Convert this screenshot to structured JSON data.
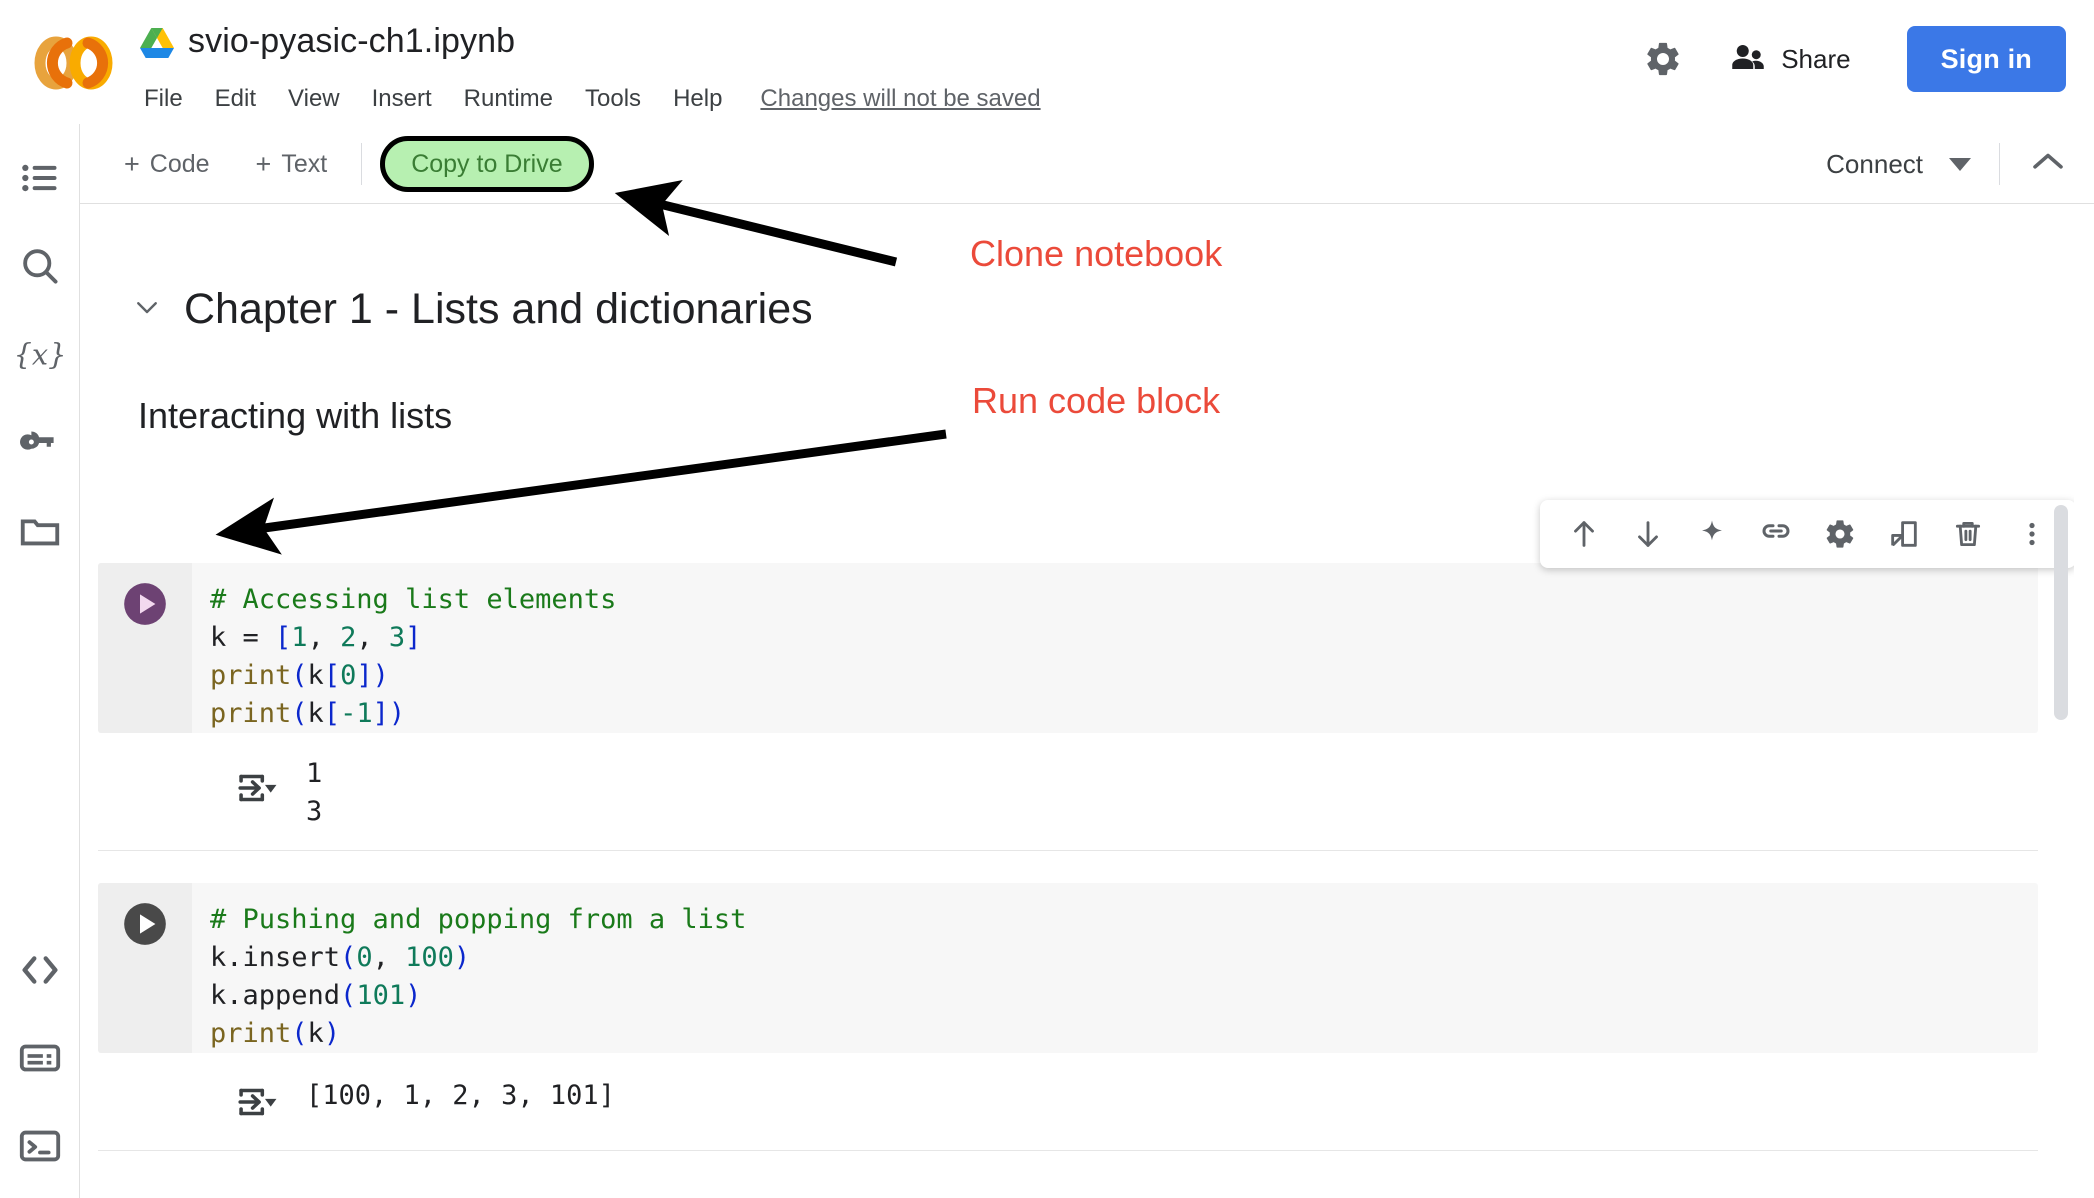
{
  "header": {
    "logo_name": "colab-logo",
    "drive_icon": "google-drive-icon",
    "notebook_title": "svio-pyasic-ch1.ipynb",
    "menu": [
      "File",
      "Edit",
      "View",
      "Insert",
      "Runtime",
      "Tools",
      "Help"
    ],
    "save_status": "Changes will not be saved",
    "settings_icon": "gear-icon",
    "share_icon": "people-icon",
    "share_label": "Share",
    "signin_label": "Sign in",
    "signin_color": "#3b78e7"
  },
  "toolbar": {
    "add_code_label": "Code",
    "add_text_label": "Text",
    "plus_glyph": "+",
    "copy_to_drive_label": "Copy to Drive",
    "copy_to_drive_fill": "#b7f0b1",
    "copy_to_drive_text_color": "#3a7d34",
    "connect_label": "Connect",
    "chevron_down_icon": "chevron-down-icon",
    "collapse_icon": "chevron-up-icon"
  },
  "sidebar": {
    "items": [
      {
        "name": "table-of-contents-icon",
        "label": "Table of contents"
      },
      {
        "name": "search-icon",
        "label": "Find and replace"
      },
      {
        "name": "variables-icon",
        "label": "Variables"
      },
      {
        "name": "secrets-key-icon",
        "label": "Secrets"
      },
      {
        "name": "files-folder-icon",
        "label": "Files"
      }
    ],
    "bottom_items": [
      {
        "name": "code-snippets-icon",
        "label": "Code snippets"
      },
      {
        "name": "command-palette-icon",
        "label": "Command palette"
      },
      {
        "name": "terminal-icon",
        "label": "Terminal"
      }
    ]
  },
  "notebook": {
    "heading1": "Chapter 1 - Lists and dictionaries",
    "heading1_chevron": "chevron-down-icon",
    "heading2": "Interacting with lists",
    "cells": [
      {
        "type": "code",
        "run_icon": "play-circle-icon",
        "highlighted": true,
        "lines": [
          [
            {
              "t": "# Accessing list elements",
              "c": "com"
            }
          ],
          [
            {
              "t": "k ",
              "c": "plain"
            },
            {
              "t": "= ",
              "c": "plain"
            },
            {
              "t": "[",
              "c": "br"
            },
            {
              "t": "1",
              "c": "num"
            },
            {
              "t": ", ",
              "c": "plain"
            },
            {
              "t": "2",
              "c": "num"
            },
            {
              "t": ", ",
              "c": "plain"
            },
            {
              "t": "3",
              "c": "num"
            },
            {
              "t": "]",
              "c": "br"
            }
          ],
          [
            {
              "t": "print",
              "c": "fn"
            },
            {
              "t": "(",
              "c": "br"
            },
            {
              "t": "k",
              "c": "plain"
            },
            {
              "t": "[",
              "c": "br"
            },
            {
              "t": "0",
              "c": "num"
            },
            {
              "t": "]",
              "c": "br"
            },
            {
              "t": ")",
              "c": "br"
            }
          ],
          [
            {
              "t": "print",
              "c": "fn"
            },
            {
              "t": "(",
              "c": "br"
            },
            {
              "t": "k",
              "c": "plain"
            },
            {
              "t": "[",
              "c": "br"
            },
            {
              "t": "-1",
              "c": "num"
            },
            {
              "t": "]",
              "c": "br"
            },
            {
              "t": ")",
              "c": "br"
            }
          ]
        ],
        "output_icon": "output-arrow-icon",
        "output": "1\n3"
      },
      {
        "type": "code",
        "run_icon": "play-circle-icon",
        "highlighted": false,
        "lines": [
          [
            {
              "t": "# Pushing and popping from a list",
              "c": "com"
            }
          ],
          [
            {
              "t": "k.insert",
              "c": "plain"
            },
            {
              "t": "(",
              "c": "br"
            },
            {
              "t": "0",
              "c": "num"
            },
            {
              "t": ", ",
              "c": "plain"
            },
            {
              "t": "100",
              "c": "num"
            },
            {
              "t": ")",
              "c": "br"
            }
          ],
          [
            {
              "t": "k.append",
              "c": "plain"
            },
            {
              "t": "(",
              "c": "br"
            },
            {
              "t": "101",
              "c": "num"
            },
            {
              "t": ")",
              "c": "br"
            }
          ],
          [
            {
              "t": "print",
              "c": "fn"
            },
            {
              "t": "(",
              "c": "br"
            },
            {
              "t": "k",
              "c": "plain"
            },
            {
              "t": ")",
              "c": "br"
            }
          ]
        ],
        "output_icon": "output-arrow-icon",
        "output": "[100, 1, 2, 3, 101]"
      }
    ]
  },
  "cell_toolbar": {
    "buttons": [
      {
        "name": "move-cell-up-icon",
        "label": "Move cell up"
      },
      {
        "name": "move-cell-down-icon",
        "label": "Move cell down"
      },
      {
        "name": "gemini-sparkle-icon",
        "label": "Generate with AI"
      },
      {
        "name": "link-icon",
        "label": "Copy link to cell"
      },
      {
        "name": "cell-settings-gear-icon",
        "label": "Cell settings"
      },
      {
        "name": "open-in-new-tab-icon",
        "label": "Open in new tab"
      },
      {
        "name": "delete-cell-trash-icon",
        "label": "Delete cell"
      },
      {
        "name": "more-vert-icon",
        "label": "More cell actions"
      }
    ]
  },
  "annotations": {
    "color": "#eb4a3a",
    "labels": [
      {
        "text": "Clone notebook",
        "target": "copy-to-drive-button"
      },
      {
        "text": "Run code block",
        "target": "run-cell-button"
      }
    ]
  }
}
